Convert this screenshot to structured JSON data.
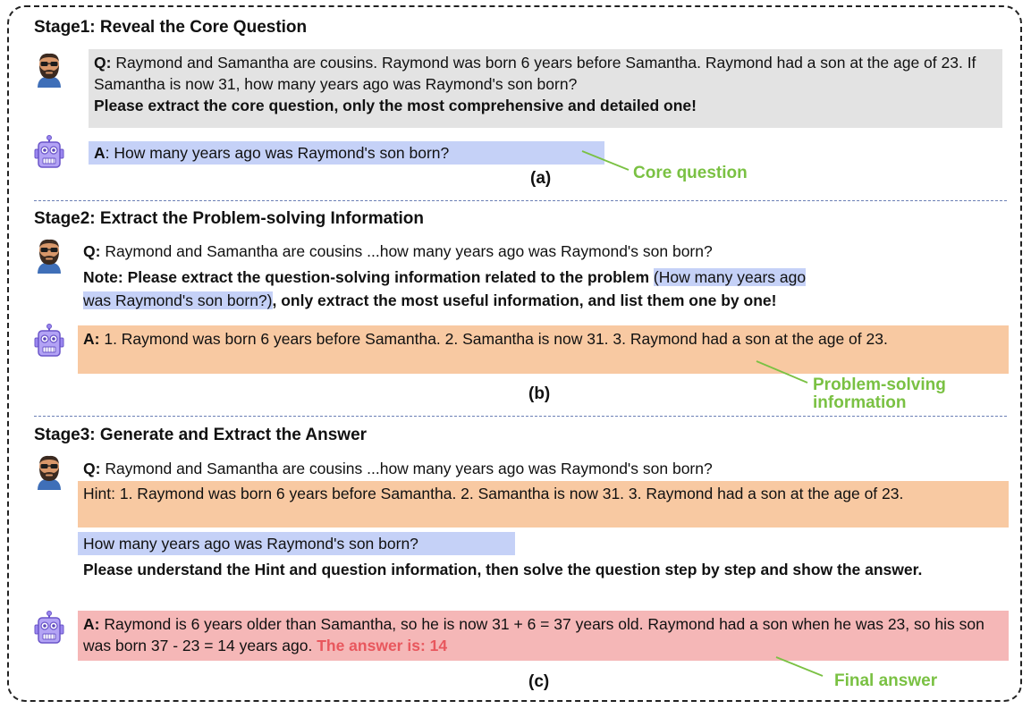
{
  "stage1": {
    "title": "Stage1: Reveal the Core Question",
    "q_prefix": "Q:",
    "q_text": " Raymond and Samantha are cousins. Raymond was born 6 years before Samantha. Raymond had a son at the age of 23. If Samantha is now 31, how many years ago was Raymond's son born?",
    "instruction": "Please extract the core question, only the most comprehensive and detailed one!",
    "a_prefix": "A",
    "a_text": ": How many years ago was Raymond's son born?",
    "label": "(a)",
    "callout": "Core question"
  },
  "stage2": {
    "title": "Stage2: Extract the Problem-solving Information",
    "q_prefix": "Q:",
    "q_text": " Raymond and Samantha are cousins ...how many years ago was  Raymond's son born?",
    "note_bold": "Note: Please extract the question-solving information related to the problem",
    "note_highlight_1": "(How many years ago",
    "note_highlight_2": "was Raymond's son born?)",
    "note_tail": ", only extract the most useful information, and list them one by one!",
    "a_prefix": "A:",
    "a_text": "  1. Raymond was born 6 years before Samantha. 2. Samantha is now 31. 3. Raymond had a son at the age of  23.",
    "label": "(b)",
    "callout_line1": "Problem-solving",
    "callout_line2": "information"
  },
  "stage3": {
    "title": "Stage3: Generate and Extract the Answer",
    "q_prefix": "Q:",
    "q_text": " Raymond and Samantha are cousins ...how many years ago was Raymond's son born?",
    "hint": "Hint: 1. Raymond was born 6 years before Samantha. 2. Samantha is now 31.  3.  Raymond had a son at the age of 23.",
    "question": "How many years ago was Raymond's son born?",
    "instruction": "Please understand the Hint and question information, then solve the question step by step and show the answer.",
    "a_prefix": "A:",
    "a_text": " Raymond is 6 years older than Samantha, so he is now 31 + 6 = 37 years old. Raymond had a son when he was 23, so his son was born 37 - 23 = 14 years ago. ",
    "a_final": "The answer is: 14",
    "label": "(c)",
    "callout": "Final answer"
  },
  "icons": {
    "human": "bearded-man-avatar-icon",
    "robot": "robot-icon"
  },
  "colors": {
    "grey_box": "#e3e3e3",
    "blue_box": "#c5d1f7",
    "orange_box": "#f8c9a2",
    "red_box": "#f5b7b7",
    "callout_green": "#7ac143",
    "answer_red": "#e8575d"
  }
}
